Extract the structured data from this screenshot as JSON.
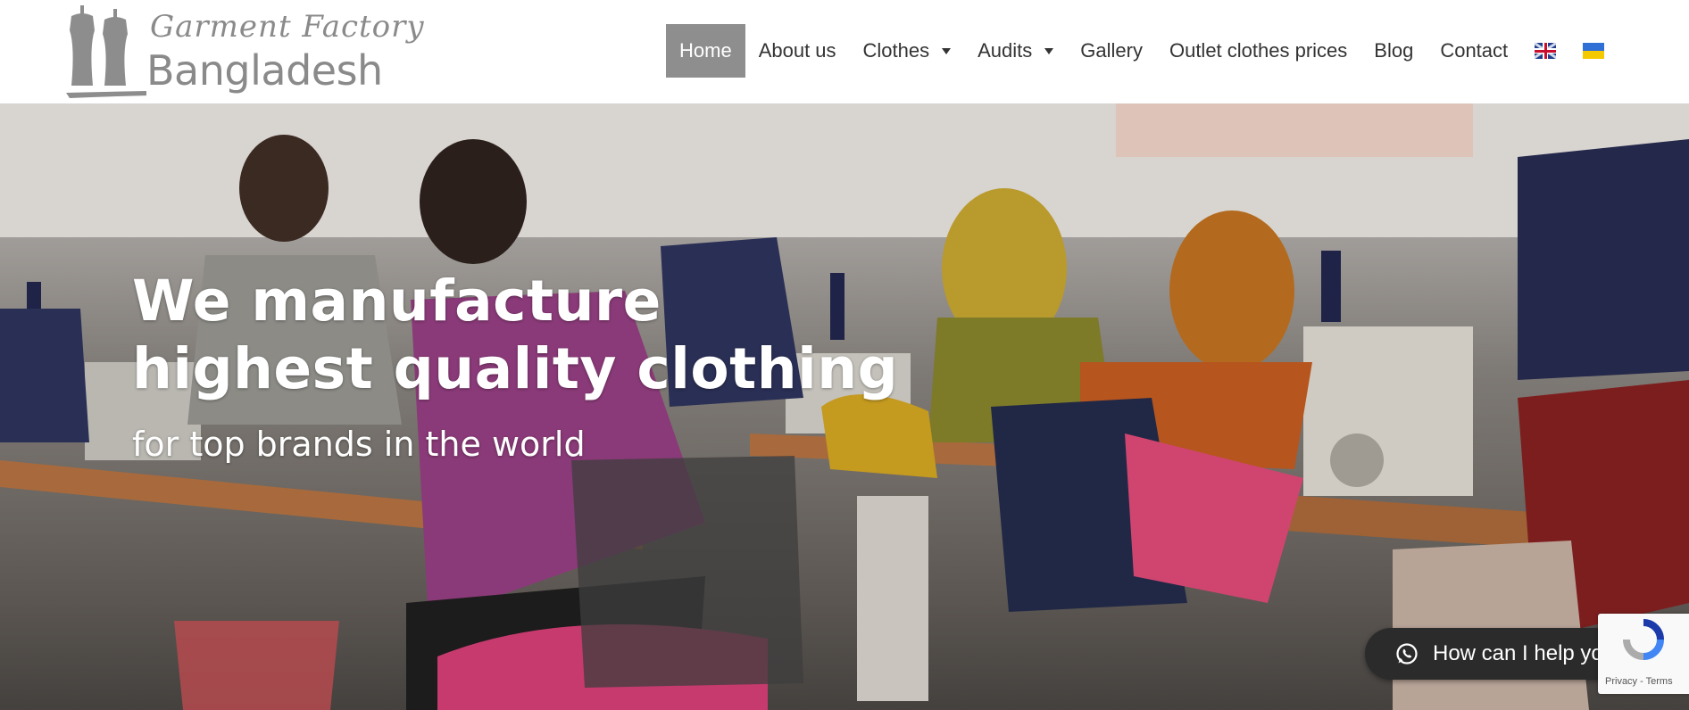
{
  "header": {
    "logo": {
      "script_text": "Garment Factory",
      "main_text": "Bangladesh"
    },
    "nav": [
      {
        "label": "Home",
        "active": true,
        "dropdown": false
      },
      {
        "label": "About us",
        "active": false,
        "dropdown": false
      },
      {
        "label": "Clothes",
        "active": false,
        "dropdown": true
      },
      {
        "label": "Audits",
        "active": false,
        "dropdown": true
      },
      {
        "label": "Gallery",
        "active": false,
        "dropdown": false
      },
      {
        "label": "Outlet clothes prices",
        "active": false,
        "dropdown": false
      },
      {
        "label": "Blog",
        "active": false,
        "dropdown": false
      },
      {
        "label": "Contact",
        "active": false,
        "dropdown": false
      }
    ],
    "languages": [
      {
        "icon": "uk-flag-icon"
      },
      {
        "icon": "ukraine-flag-icon"
      }
    ]
  },
  "hero": {
    "title": "We manufacture highest quality clothing",
    "subtitle": "for top brands in the world",
    "background": "garment-factory-photo"
  },
  "chat_button": {
    "icon": "whatsapp-icon",
    "label": "How can I help you?"
  },
  "recaptcha": {
    "links": "Privacy - Terms"
  },
  "colors": {
    "nav_active_bg": "#8e8e8e",
    "nav_text": "#333333",
    "logo_gray": "#8a8a8a",
    "chat_button_bg": "#2b2b2b"
  }
}
